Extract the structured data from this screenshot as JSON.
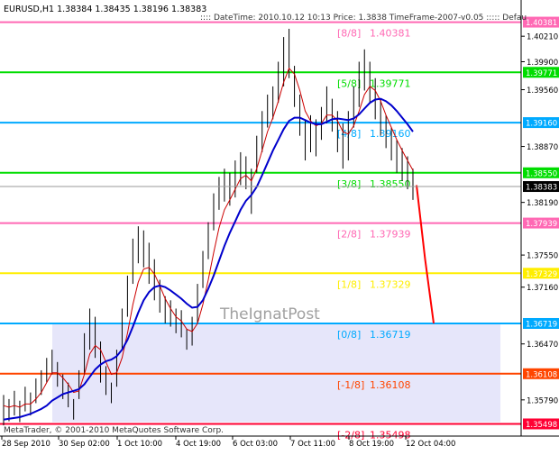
{
  "window": {
    "symbol_label": "EURUSD,H1  1.38384 1.38435 1.38196 1.38383",
    "info_line": ":::: DateTime: 2010.10.12 10:13    Price: 1.3838    TimeFrame-2007-v0.05    ::::: Defau",
    "watermark": "TheIgnatPost",
    "copyright": "MetaTrader, © 2001-2010 MetaQuotes Software Corp."
  },
  "colors": {
    "background": "#ffffff",
    "price_bars": "#000000",
    "ma_fast": "#cc0000",
    "ma_slow": "#0000cc",
    "forecast": "#ff0000",
    "zone_fill": "#e6e6fa",
    "current_price_bg": "#000000"
  },
  "chart_data": {
    "type": "line",
    "ylim": [
      1.3535,
      1.4065
    ],
    "y_ticks": [
      "1.40210",
      "1.39900",
      "1.39560",
      "1.38870",
      "1.38190",
      "1.37550",
      "1.37160",
      "1.36470",
      "1.35790"
    ],
    "x_tick_labels": [
      "28 Sep 2010",
      "30 Sep 02:00",
      "1 Oct 10:00",
      "4 Oct 19:00",
      "6 Oct 03:00",
      "7 Oct 11:00",
      "8 Oct 19:00",
      "12 Oct 04:00"
    ],
    "current_price": "1.38383",
    "murrey_levels": [
      {
        "label": "[8/8]",
        "price_text": "1.40381",
        "tag": "1.40381",
        "value": 1.40381,
        "color": "#ff69b4"
      },
      {
        "label": "[5/8]",
        "price_text": "1.39771",
        "tag": "1.39771",
        "value": 1.39771,
        "color": "#00dd00"
      },
      {
        "label": "[4/8]",
        "price_text": "1.39160",
        "tag": "1.39160",
        "value": 1.3916,
        "color": "#00aaff"
      },
      {
        "label": "[3/8]",
        "price_text": "1.38550",
        "tag": "1.38550",
        "value": 1.3855,
        "color": "#00dd00"
      },
      {
        "label": "[2/8]",
        "price_text": "1.37939",
        "tag": "1.37939",
        "value": 1.37939,
        "color": "#ff69b4"
      },
      {
        "label": "[1/8]",
        "price_text": "1.37329",
        "tag": "1.37329",
        "value": 1.37329,
        "color": "#ffee00"
      },
      {
        "label": "[0/8]",
        "price_text": "1.36719",
        "tag": "1.36719",
        "value": 1.36719,
        "color": "#00aaff"
      },
      {
        "label": "[-1/8]",
        "price_text": "1.36108",
        "tag": "1.36108",
        "value": 1.36108,
        "color": "#ff4500"
      },
      {
        "label": "[-2/8]",
        "price_text": "1.35498",
        "tag": "1.35498",
        "value": 1.35498,
        "color": "#ff0033"
      }
    ],
    "price_bars": [
      [
        1.3585,
        1.3548
      ],
      [
        1.358,
        1.3553
      ],
      [
        1.359,
        1.356
      ],
      [
        1.3578,
        1.3552
      ],
      [
        1.3595,
        1.3565
      ],
      [
        1.3588,
        1.356
      ],
      [
        1.3605,
        1.3575
      ],
      [
        1.3615,
        1.3585
      ],
      [
        1.363,
        1.36
      ],
      [
        1.364,
        1.361
      ],
      [
        1.3625,
        1.3595
      ],
      [
        1.361,
        1.358
      ],
      [
        1.36,
        1.357
      ],
      [
        1.358,
        1.3555
      ],
      [
        1.3615,
        1.358
      ],
      [
        1.366,
        1.361
      ],
      [
        1.369,
        1.364
      ],
      [
        1.368,
        1.363
      ],
      [
        1.365,
        1.36
      ],
      [
        1.362,
        1.3585
      ],
      [
        1.36,
        1.3575
      ],
      [
        1.364,
        1.3595
      ],
      [
        1.369,
        1.364
      ],
      [
        1.373,
        1.368
      ],
      [
        1.3775,
        1.372
      ],
      [
        1.379,
        1.3745
      ],
      [
        1.3785,
        1.374
      ],
      [
        1.377,
        1.372
      ],
      [
        1.375,
        1.37
      ],
      [
        1.3725,
        1.3685
      ],
      [
        1.3705,
        1.3672
      ],
      [
        1.37,
        1.3668
      ],
      [
        1.369,
        1.366
      ],
      [
        1.3688,
        1.3655
      ],
      [
        1.3665,
        1.364
      ],
      [
        1.368,
        1.3645
      ],
      [
        1.372,
        1.3672
      ],
      [
        1.376,
        1.3715
      ],
      [
        1.3795,
        1.375
      ],
      [
        1.383,
        1.3785
      ],
      [
        1.385,
        1.381
      ],
      [
        1.386,
        1.382
      ],
      [
        1.3855,
        1.3815
      ],
      [
        1.387,
        1.3825
      ],
      [
        1.388,
        1.384
      ],
      [
        1.3875,
        1.3835
      ],
      [
        1.386,
        1.3805
      ],
      [
        1.39,
        1.3855
      ],
      [
        1.393,
        1.388
      ],
      [
        1.395,
        1.391
      ],
      [
        1.396,
        1.392
      ],
      [
        1.399,
        1.394
      ],
      [
        1.402,
        1.396
      ],
      [
        1.403,
        1.397
      ],
      [
        1.3985,
        1.3935
      ],
      [
        1.395,
        1.39
      ],
      [
        1.392,
        1.387
      ],
      [
        1.3925,
        1.388
      ],
      [
        1.392,
        1.3875
      ],
      [
        1.3935,
        1.3895
      ],
      [
        1.396,
        1.3915
      ],
      [
        1.3945,
        1.3905
      ],
      [
        1.393,
        1.388
      ],
      [
        1.3915,
        1.386
      ],
      [
        1.393,
        1.387
      ],
      [
        1.396,
        1.391
      ],
      [
        1.399,
        1.3935
      ],
      [
        1.4005,
        1.3955
      ],
      [
        1.399,
        1.394
      ],
      [
        1.397,
        1.392
      ],
      [
        1.3945,
        1.39
      ],
      [
        1.3925,
        1.3885
      ],
      [
        1.391,
        1.387
      ],
      [
        1.3895,
        1.3855
      ],
      [
        1.3885,
        1.3845
      ],
      [
        1.3875,
        1.3835
      ],
      [
        1.386,
        1.3822
      ]
    ],
    "ma_fast": [
      1.3572,
      1.357,
      1.3572,
      1.357,
      1.3574,
      1.3574,
      1.358,
      1.3588,
      1.36,
      1.3612,
      1.3612,
      1.3606,
      1.3598,
      1.3588,
      1.359,
      1.361,
      1.3635,
      1.3645,
      1.364,
      1.3625,
      1.361,
      1.3612,
      1.363,
      1.366,
      1.3695,
      1.3722,
      1.3738,
      1.374,
      1.3732,
      1.3718,
      1.3702,
      1.369,
      1.368,
      1.3675,
      1.3665,
      1.3662,
      1.3672,
      1.3695,
      1.3725,
      1.3758,
      1.3788,
      1.381,
      1.3822,
      1.3835,
      1.3848,
      1.3852,
      1.3845,
      1.386,
      1.3882,
      1.3905,
      1.3922,
      1.3942,
      1.3965,
      1.3982,
      1.3975,
      1.3955,
      1.393,
      1.3918,
      1.3912,
      1.3915,
      1.3925,
      1.3925,
      1.3918,
      1.3905,
      1.3902,
      1.3912,
      1.393,
      1.395,
      1.396,
      1.3955,
      1.3942,
      1.3925,
      1.391,
      1.3895,
      1.3882,
      1.387,
      1.3858
    ],
    "ma_slow": [
      1.3555,
      1.3556,
      1.3557,
      1.3558,
      1.356,
      1.3562,
      1.3565,
      1.3568,
      1.3572,
      1.3578,
      1.3582,
      1.3586,
      1.3588,
      1.359,
      1.3592,
      1.3598,
      1.3607,
      1.3616,
      1.3622,
      1.3626,
      1.3628,
      1.3632,
      1.364,
      1.3652,
      1.3668,
      1.3685,
      1.37,
      1.371,
      1.3716,
      1.3718,
      1.3716,
      1.3712,
      1.3707,
      1.3702,
      1.3696,
      1.3691,
      1.3692,
      1.37,
      1.3714,
      1.373,
      1.3748,
      1.3766,
      1.3782,
      1.3796,
      1.381,
      1.3821,
      1.3828,
      1.3838,
      1.3852,
      1.3867,
      1.3882,
      1.3895,
      1.3908,
      1.3918,
      1.3922,
      1.3922,
      1.3919,
      1.3916,
      1.3914,
      1.3914,
      1.3917,
      1.392,
      1.3921,
      1.392,
      1.3919,
      1.3921,
      1.3926,
      1.3933,
      1.394,
      1.3944,
      1.3945,
      1.3942,
      1.3937,
      1.393,
      1.3922,
      1.3914,
      1.3905
    ],
    "forecast": [
      [
        1.384,
        0
      ],
      [
        1.375,
        0.5
      ],
      [
        1.3672,
        1
      ]
    ],
    "zone": {
      "top": 1.36719,
      "bottom": 1.3552
    }
  }
}
